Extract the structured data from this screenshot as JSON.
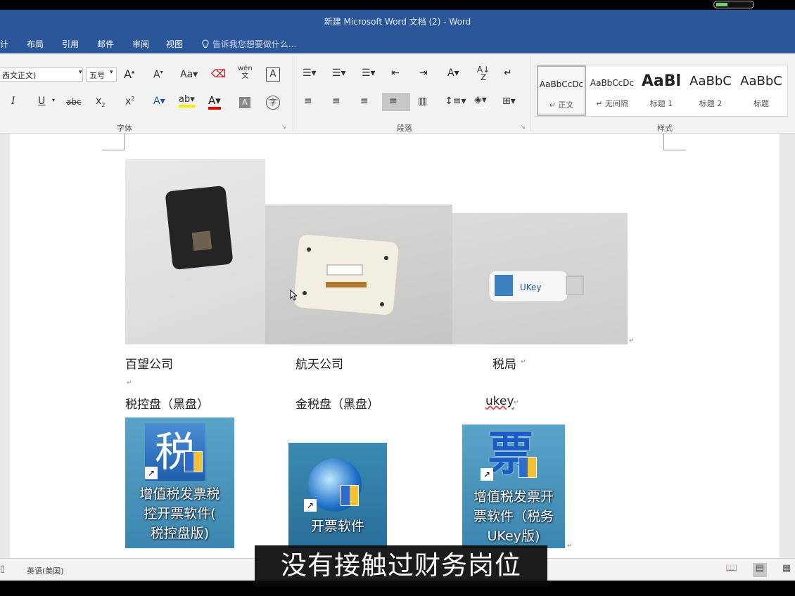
{
  "window": {
    "title": "新建 Microsoft Word 文档 (2) - Word"
  },
  "menu": {
    "items": [
      "计",
      "布局",
      "引用",
      "邮件",
      "审阅",
      "视图"
    ],
    "tell_me": "告诉我您想要做什么..."
  },
  "ribbon": {
    "font_name": "西文正文)",
    "font_size": "五号",
    "groups": {
      "font": "字体",
      "paragraph": "段落",
      "styles": "样式"
    },
    "styles": [
      {
        "sample": "AaBbCcDc",
        "name": "↵ 正文"
      },
      {
        "sample": "AaBbCcDc",
        "name": "↵ 无间隔"
      },
      {
        "sample": "AaBl",
        "name": "标题 1"
      },
      {
        "sample": "AaBbC",
        "name": "标题 2"
      },
      {
        "sample": "AaBbC",
        "name": "标题"
      }
    ]
  },
  "document": {
    "row1": [
      "百望公司",
      "航天公司",
      "税局"
    ],
    "row2": [
      "税控盘（黑盘）",
      "金税盘（黑盘）",
      "ukey"
    ],
    "icons": [
      {
        "glyph": "税",
        "caption_lines": [
          "增值税发票税",
          "控开票软件(",
          "税控盘版)"
        ]
      },
      {
        "glyph": "",
        "caption_lines": [
          "开票软件"
        ]
      },
      {
        "glyph": "票",
        "caption_lines": [
          "增值税发票开",
          "票软件（税务",
          "UKey版)"
        ]
      }
    ]
  },
  "status": {
    "language": "英语(美国)"
  },
  "subtitle": "没有接触过财务岗位",
  "colors": {
    "accent": "#2b579a",
    "ribbon_bg": "#f3f3f3",
    "page_bg": "#ffffff"
  }
}
